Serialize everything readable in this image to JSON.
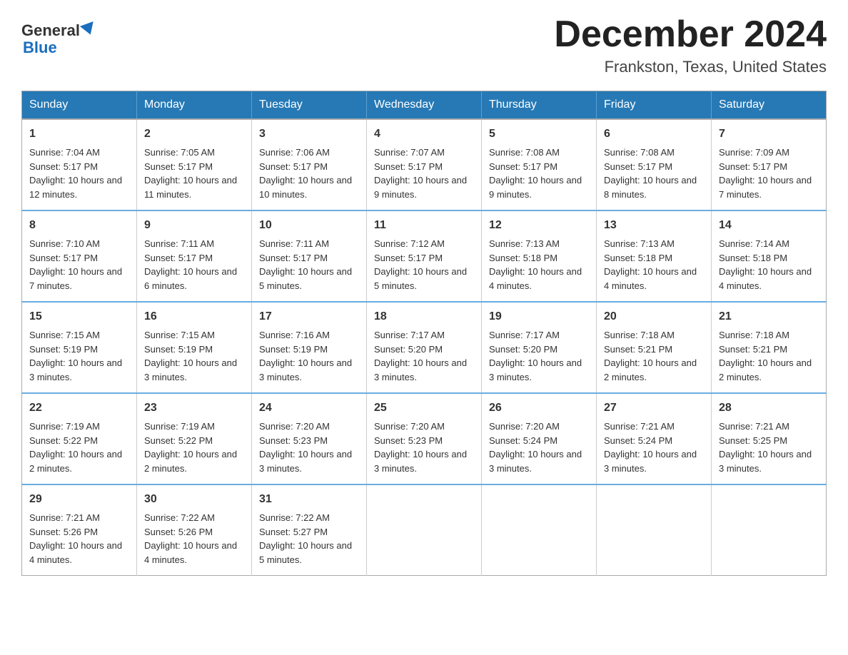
{
  "logo": {
    "general": "General",
    "blue": "Blue"
  },
  "title": "December 2024",
  "location": "Frankston, Texas, United States",
  "days_of_week": [
    "Sunday",
    "Monday",
    "Tuesday",
    "Wednesday",
    "Thursday",
    "Friday",
    "Saturday"
  ],
  "weeks": [
    [
      {
        "day": "1",
        "sunrise": "7:04 AM",
        "sunset": "5:17 PM",
        "daylight": "10 hours and 12 minutes."
      },
      {
        "day": "2",
        "sunrise": "7:05 AM",
        "sunset": "5:17 PM",
        "daylight": "10 hours and 11 minutes."
      },
      {
        "day": "3",
        "sunrise": "7:06 AM",
        "sunset": "5:17 PM",
        "daylight": "10 hours and 10 minutes."
      },
      {
        "day": "4",
        "sunrise": "7:07 AM",
        "sunset": "5:17 PM",
        "daylight": "10 hours and 9 minutes."
      },
      {
        "day": "5",
        "sunrise": "7:08 AM",
        "sunset": "5:17 PM",
        "daylight": "10 hours and 9 minutes."
      },
      {
        "day": "6",
        "sunrise": "7:08 AM",
        "sunset": "5:17 PM",
        "daylight": "10 hours and 8 minutes."
      },
      {
        "day": "7",
        "sunrise": "7:09 AM",
        "sunset": "5:17 PM",
        "daylight": "10 hours and 7 minutes."
      }
    ],
    [
      {
        "day": "8",
        "sunrise": "7:10 AM",
        "sunset": "5:17 PM",
        "daylight": "10 hours and 7 minutes."
      },
      {
        "day": "9",
        "sunrise": "7:11 AM",
        "sunset": "5:17 PM",
        "daylight": "10 hours and 6 minutes."
      },
      {
        "day": "10",
        "sunrise": "7:11 AM",
        "sunset": "5:17 PM",
        "daylight": "10 hours and 5 minutes."
      },
      {
        "day": "11",
        "sunrise": "7:12 AM",
        "sunset": "5:17 PM",
        "daylight": "10 hours and 5 minutes."
      },
      {
        "day": "12",
        "sunrise": "7:13 AM",
        "sunset": "5:18 PM",
        "daylight": "10 hours and 4 minutes."
      },
      {
        "day": "13",
        "sunrise": "7:13 AM",
        "sunset": "5:18 PM",
        "daylight": "10 hours and 4 minutes."
      },
      {
        "day": "14",
        "sunrise": "7:14 AM",
        "sunset": "5:18 PM",
        "daylight": "10 hours and 4 minutes."
      }
    ],
    [
      {
        "day": "15",
        "sunrise": "7:15 AM",
        "sunset": "5:19 PM",
        "daylight": "10 hours and 3 minutes."
      },
      {
        "day": "16",
        "sunrise": "7:15 AM",
        "sunset": "5:19 PM",
        "daylight": "10 hours and 3 minutes."
      },
      {
        "day": "17",
        "sunrise": "7:16 AM",
        "sunset": "5:19 PM",
        "daylight": "10 hours and 3 minutes."
      },
      {
        "day": "18",
        "sunrise": "7:17 AM",
        "sunset": "5:20 PM",
        "daylight": "10 hours and 3 minutes."
      },
      {
        "day": "19",
        "sunrise": "7:17 AM",
        "sunset": "5:20 PM",
        "daylight": "10 hours and 3 minutes."
      },
      {
        "day": "20",
        "sunrise": "7:18 AM",
        "sunset": "5:21 PM",
        "daylight": "10 hours and 2 minutes."
      },
      {
        "day": "21",
        "sunrise": "7:18 AM",
        "sunset": "5:21 PM",
        "daylight": "10 hours and 2 minutes."
      }
    ],
    [
      {
        "day": "22",
        "sunrise": "7:19 AM",
        "sunset": "5:22 PM",
        "daylight": "10 hours and 2 minutes."
      },
      {
        "day": "23",
        "sunrise": "7:19 AM",
        "sunset": "5:22 PM",
        "daylight": "10 hours and 2 minutes."
      },
      {
        "day": "24",
        "sunrise": "7:20 AM",
        "sunset": "5:23 PM",
        "daylight": "10 hours and 3 minutes."
      },
      {
        "day": "25",
        "sunrise": "7:20 AM",
        "sunset": "5:23 PM",
        "daylight": "10 hours and 3 minutes."
      },
      {
        "day": "26",
        "sunrise": "7:20 AM",
        "sunset": "5:24 PM",
        "daylight": "10 hours and 3 minutes."
      },
      {
        "day": "27",
        "sunrise": "7:21 AM",
        "sunset": "5:24 PM",
        "daylight": "10 hours and 3 minutes."
      },
      {
        "day": "28",
        "sunrise": "7:21 AM",
        "sunset": "5:25 PM",
        "daylight": "10 hours and 3 minutes."
      }
    ],
    [
      {
        "day": "29",
        "sunrise": "7:21 AM",
        "sunset": "5:26 PM",
        "daylight": "10 hours and 4 minutes."
      },
      {
        "day": "30",
        "sunrise": "7:22 AM",
        "sunset": "5:26 PM",
        "daylight": "10 hours and 4 minutes."
      },
      {
        "day": "31",
        "sunrise": "7:22 AM",
        "sunset": "5:27 PM",
        "daylight": "10 hours and 5 minutes."
      },
      null,
      null,
      null,
      null
    ]
  ],
  "labels": {
    "sunrise_prefix": "Sunrise: ",
    "sunset_prefix": "Sunset: ",
    "daylight_prefix": "Daylight: "
  }
}
